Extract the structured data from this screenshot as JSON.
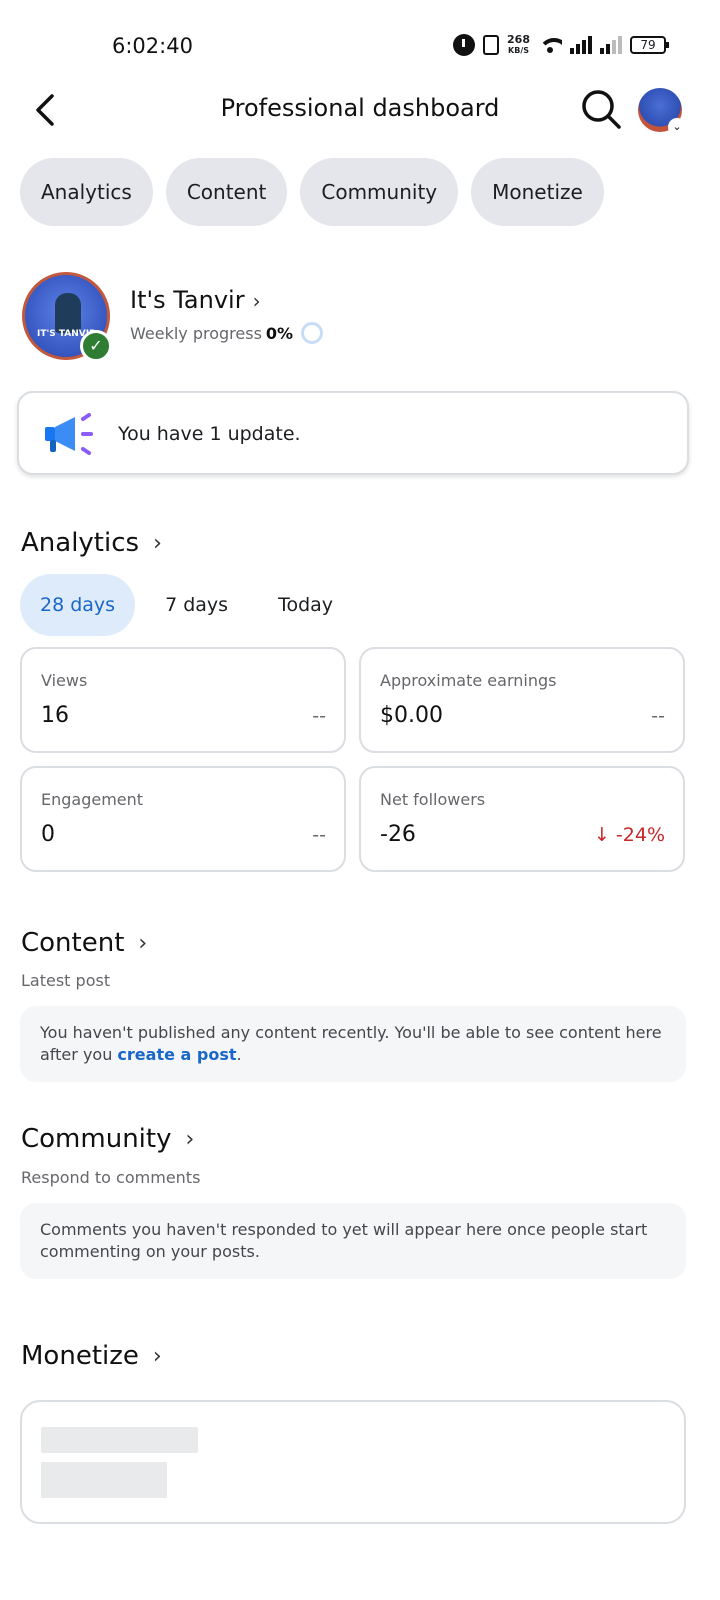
{
  "status_bar": {
    "time": "6:02:40",
    "speed_value": "268",
    "speed_unit": "KB/S",
    "battery": "79"
  },
  "header": {
    "title": "Professional dashboard"
  },
  "chips": [
    {
      "label": "Analytics"
    },
    {
      "label": "Content"
    },
    {
      "label": "Community"
    },
    {
      "label": "Monetize"
    }
  ],
  "profile": {
    "name": "It's Tanvir",
    "avatar_text": "IT'S TANVIR",
    "weekly_label": "Weekly progress",
    "weekly_value": "0%"
  },
  "update": {
    "text": "You have 1 update."
  },
  "analytics": {
    "title": "Analytics",
    "tabs": [
      {
        "label": "28 days",
        "active": true
      },
      {
        "label": "7 days",
        "active": false
      },
      {
        "label": "Today",
        "active": false
      }
    ],
    "cards": [
      {
        "label": "Views",
        "value": "16",
        "change": "--"
      },
      {
        "label": "Approximate earnings",
        "value": "$0.00",
        "change": "--"
      },
      {
        "label": "Engagement",
        "value": "0",
        "change": "--"
      },
      {
        "label": "Net followers",
        "value": "-26",
        "change": "↓ -24%"
      }
    ]
  },
  "content": {
    "title": "Content",
    "subtitle": "Latest post",
    "info_text": "You haven't published any content recently. You'll be able to see content here after you ",
    "info_link": "create a post",
    "info_end": "."
  },
  "community": {
    "title": "Community",
    "subtitle": "Respond to comments",
    "info_text": "Comments you haven't responded to yet will appear here once people start commenting on your posts."
  },
  "monetize": {
    "title": "Monetize"
  },
  "colors": {
    "accent": "#1a66c9",
    "negative": "#c62828",
    "chip_bg": "#e4e6eb",
    "active_tab_bg": "#deebfa"
  }
}
